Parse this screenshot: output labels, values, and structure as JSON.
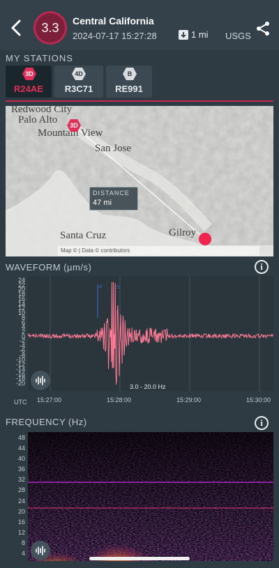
{
  "header": {
    "magnitude": "3.3",
    "region": "Central California",
    "timestamp": "2024-07-17 15:27:28",
    "depth": "1 mi",
    "source": "USGS"
  },
  "stations": {
    "title": "MY STATIONS",
    "items": [
      {
        "badge": "3D",
        "code": "R24AE",
        "selected": true
      },
      {
        "badge": "4D",
        "code": "R3C71",
        "selected": false
      },
      {
        "badge": "B",
        "code": "RE991",
        "selected": false
      }
    ]
  },
  "map": {
    "places": [
      "Redwood City",
      "Palo Alto",
      "Mountain View",
      "San Jose",
      "Santa Cruz",
      "Gilroy"
    ],
    "station_marker": "3D",
    "distance_label": "DISTANCE",
    "distance_value": "47 mi",
    "attribution": "Map © | Data © contributors"
  },
  "waveform": {
    "title": "WAVEFORM (µm/s)",
    "filter": "3.0 - 20.0 Hz",
    "utc_label": "UTC",
    "y_ticks": [
      "24",
      "22",
      "20",
      "18",
      "16",
      "14",
      "12",
      "10",
      "8",
      "6",
      "4",
      "2",
      "0",
      "-2",
      "-4",
      "-6",
      "-8",
      "-10",
      "-12",
      "-14",
      "-16",
      "-18",
      "-20"
    ],
    "x_ticks": [
      "15:27:00",
      "15:28:00",
      "15:29:00",
      "15:30:00"
    ],
    "phase_labels": [
      "P",
      "S"
    ]
  },
  "frequency": {
    "title": "FREQUENCY (Hz)",
    "y_ticks": [
      "48",
      "44",
      "40",
      "36",
      "32",
      "28",
      "24",
      "20",
      "16",
      "12",
      "8",
      "4"
    ]
  },
  "colors": {
    "accent": "#e0305a",
    "waveform": "#ff7a95",
    "background": "#2f3b43"
  }
}
